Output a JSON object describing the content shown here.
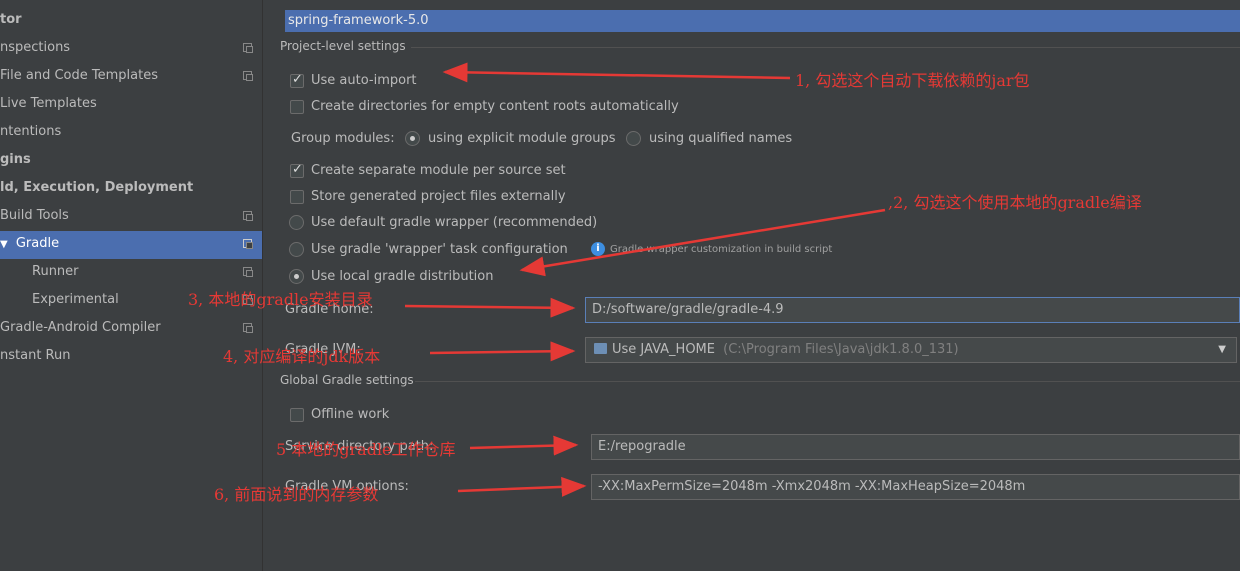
{
  "sidebar": {
    "items": [
      {
        "label": "tor",
        "bold": true
      },
      {
        "label": "nspections",
        "icon": "copy-icon"
      },
      {
        "label": "File and Code Templates",
        "icon": "copy-icon"
      },
      {
        "label": "Live Templates"
      },
      {
        "label": "ntentions"
      },
      {
        "label": "gins",
        "bold": true
      },
      {
        "label": "ld, Execution, Deployment",
        "bold": true
      },
      {
        "label": "Build Tools",
        "icon": "copy-icon"
      },
      {
        "label": "Gradle",
        "selected": true,
        "arrow": "▼",
        "icon": "copy-icon"
      },
      {
        "label": "Runner",
        "icon": "copy-icon"
      },
      {
        "label": "Experimental",
        "icon": "copy-icon"
      },
      {
        "label": "Gradle-Android Compiler",
        "icon": "copy-icon"
      },
      {
        "label": "nstant Run"
      }
    ]
  },
  "project_field": "spring-framework-5.0",
  "project_level": {
    "title": "Project-level settings",
    "use_auto_import": "Use auto-import",
    "create_dirs": "Create directories for empty content roots automatically",
    "group_modules": {
      "label": "Group modules:",
      "opt1": "using explicit module groups",
      "opt2": "using qualified names"
    },
    "separate_module": "Create separate module per source set",
    "store_external": "Store generated project files externally",
    "default_wrapper": "Use default gradle wrapper (recommended)",
    "wrapper_task": "Use gradle 'wrapper' task configuration",
    "wrapper_hint": "Gradle wrapper customization in build script",
    "local_distribution": "Use local gradle distribution",
    "gradle_home_label": "Gradle home:",
    "gradle_home_value": "D:/software/gradle/gradle-4.9",
    "gradle_jvm_label": "Gradle JVM:",
    "gradle_jvm_value": "Use JAVA_HOME",
    "gradle_jvm_path": "(C:\\Program Files\\Java\\jdk1.8.0_131)"
  },
  "global": {
    "title": "Global Gradle settings",
    "offline": "Offline work",
    "service_dir_label": "Service directory path:",
    "service_dir_value": "E:/repogradle",
    "vm_options_label": "Gradle VM options:",
    "vm_options_value": "-XX:MaxPermSize=2048m -Xmx2048m -XX:MaxHeapSize=2048m"
  },
  "annotations": {
    "a1": "1, 勾选这个自动下载依赖的jar包",
    "a2": ",2, 勾选这个使用本地的gradle编译",
    "a3": "3, 本地的gradle安装目录",
    "a4": "4, 对应编译的jdk版本",
    "a5": "5 本地的gradle工作仓库",
    "a6": "6, 前面说到的内存参数"
  },
  "colors": {
    "background": "#3c3f41",
    "selection": "#4b6eaf",
    "annotation": "#e53935",
    "text": "#bbbbbb"
  }
}
